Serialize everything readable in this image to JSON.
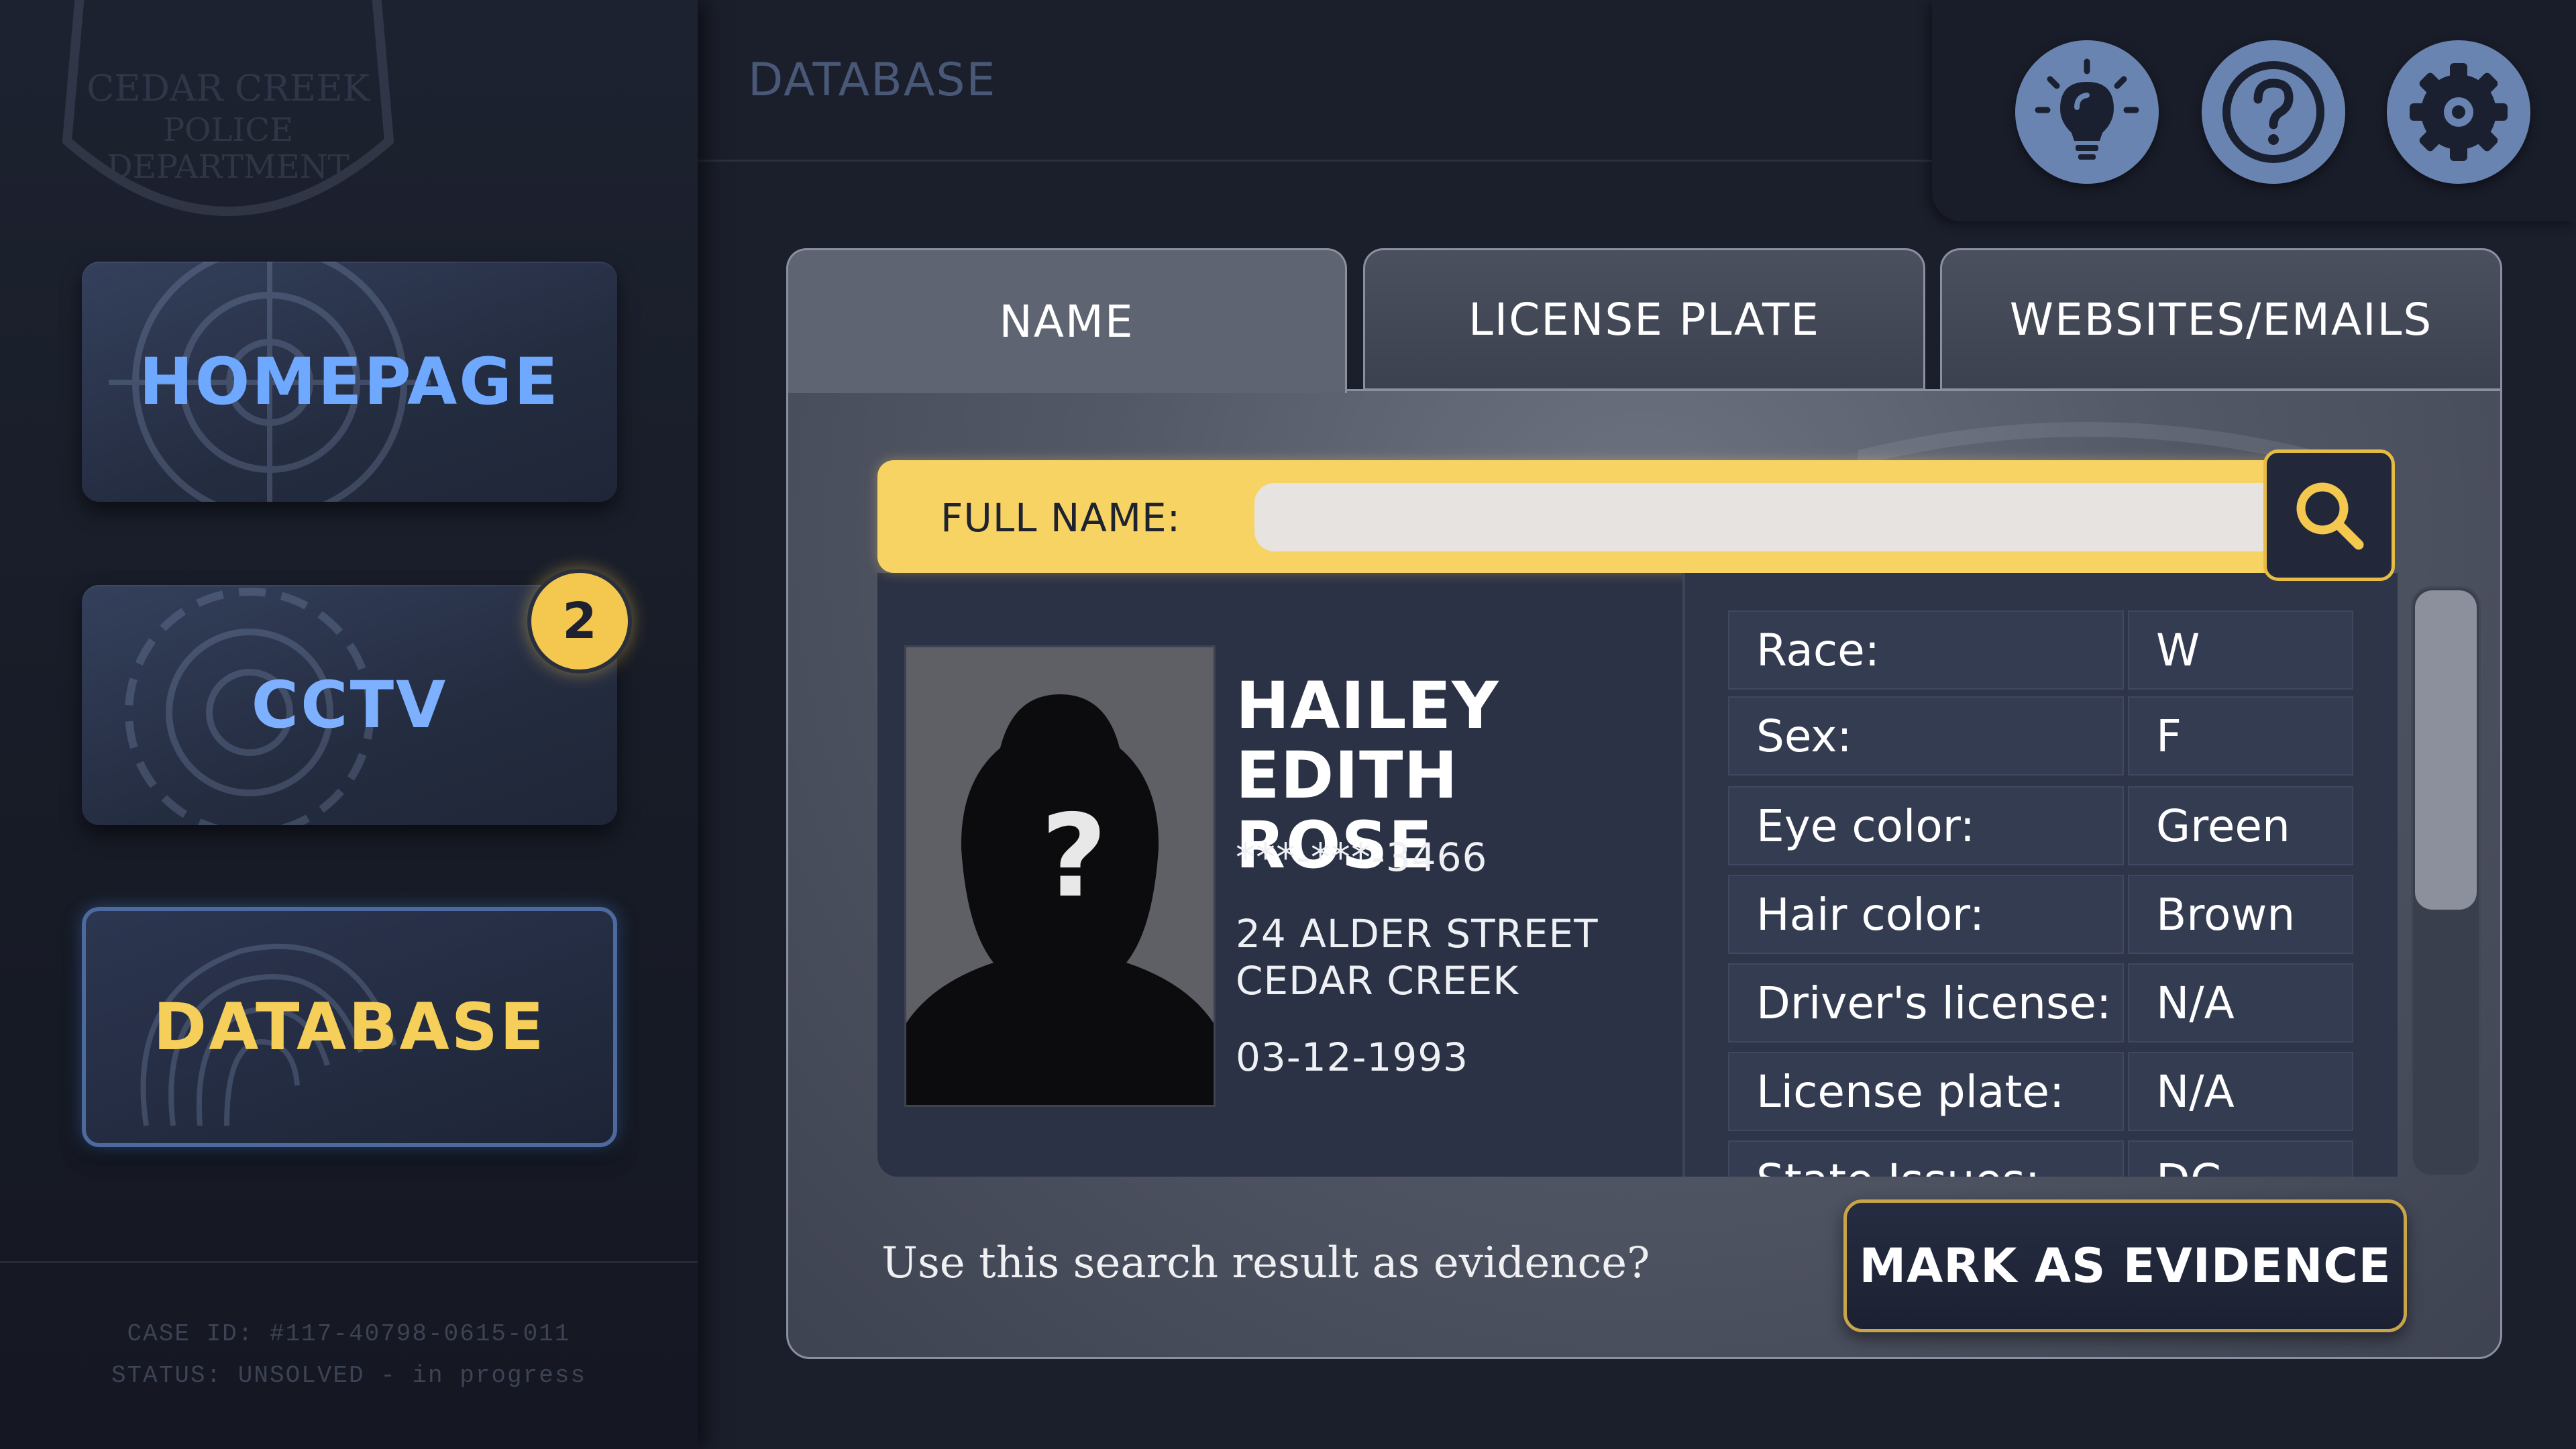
{
  "header": {
    "title": "DATABASE"
  },
  "toolbar": {
    "icons": [
      "lightbulb-icon",
      "question-icon",
      "gear-icon"
    ]
  },
  "sidebar": {
    "emblem_text": [
      "CEDAR CREEK",
      "POLICE",
      "DEPARTMENT"
    ],
    "items": [
      {
        "label": "HOMEPAGE",
        "color": "#6fa8ff"
      },
      {
        "label": "CCTV",
        "color": "#7db1ff",
        "badge": "2"
      },
      {
        "label": "DATABASE",
        "color": "#f5cf5a",
        "active": true
      }
    ],
    "case_id": "CASE ID: #117-40798-0615-011",
    "status": "STATUS: UNSOLVED - in progress"
  },
  "tabs": [
    {
      "label": "NAME",
      "active": true
    },
    {
      "label": "LICENSE PLATE",
      "active": false
    },
    {
      "label": "WEBSITES/EMAILS",
      "active": false
    }
  ],
  "search": {
    "label": "FULL NAME:",
    "value": "",
    "placeholder": ""
  },
  "panel_emblem_text": [
    "CEDAR CREEK",
    "POLICE",
    "DEPARTMENT"
  ],
  "result": {
    "photo_glyph": "?",
    "name_line1": "HAILEY",
    "name_line2": "EDITH ROSE",
    "ssn": "***-***-3466",
    "address_line1": "24 ALDER STREET",
    "address_line2": "CEDAR CREEK",
    "dob": "03-12-1993",
    "attributes": [
      {
        "key": "Race:",
        "value": "W"
      },
      {
        "key": "Sex:",
        "value": "F"
      },
      {
        "key": "Eye color:",
        "value": "Green"
      },
      {
        "key": "Hair color:",
        "value": "Brown"
      },
      {
        "key": "Driver's license:",
        "value": "N/A"
      },
      {
        "key": "License plate:",
        "value": "N/A"
      },
      {
        "key": "State Issues:",
        "value": "DC"
      }
    ]
  },
  "evidence": {
    "question": "Use this search result as evidence?",
    "button_label": "MARK AS EVIDENCE"
  },
  "colors": {
    "accent_yellow": "#f7d364",
    "accent_blue": "#6fa8ff",
    "icon_blue": "#6a84b1"
  }
}
